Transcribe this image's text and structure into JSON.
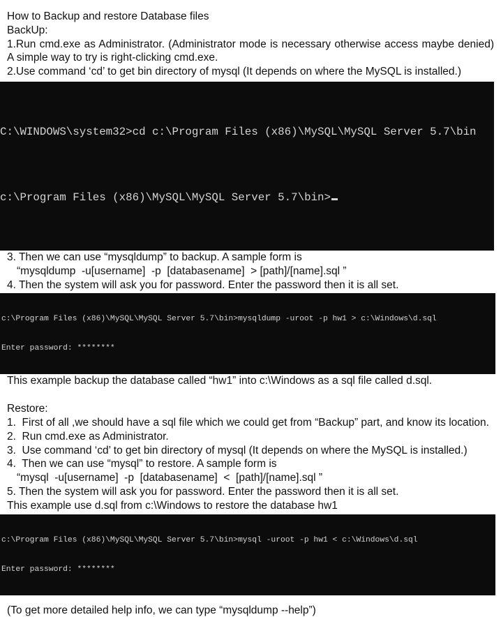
{
  "title": "How to Backup and restore Database files",
  "backup": {
    "heading": "BackUp:",
    "step1": "1.Run cmd.exe as Administrator. (Administrator mode is necessary otherwise access maybe denied) A simple way to try is right-clicking cmd.exe.",
    "step2": "2.Use command ‘cd’ to get bin directory of mysql (It depends on where the MySQL is installed.)",
    "console_cd": {
      "line1": "C:\\WINDOWS\\system32>cd c:\\Program Files (x86)\\MySQL\\MySQL Server 5.7\\bin",
      "line2": "c:\\Program Files (x86)\\MySQL\\MySQL Server 5.7\\bin>"
    },
    "step3": "3. Then we can use “mysqldump” to backup. A sample form is",
    "step3_form": "“mysqldump  -u[username]  -p  [databasename]  > [path]/[name].sql ”",
    "step4": "4. Then the system will ask you for password. Enter the password then it is all set.",
    "console_dump": {
      "line1": "c:\\Program Files (x86)\\MySQL\\MySQL Server 5.7\\bin>mysqldump -uroot -p hw1 > c:\\Windows\\d.sql",
      "line2": "Enter password: ********"
    },
    "example": "This example backup the database called “hw1” into c:\\Windows as a sql file called d.sql."
  },
  "restore": {
    "heading": "Restore:",
    "step1": "1.  First of all ,we should have a sql file which we could get from “Backup” part, and know its location.",
    "step2": "2.  Run cmd.exe as Administrator.",
    "step3": "3.  Use command ‘cd’ to get bin directory of mysql (It depends on where the MySQL is installed.)",
    "step4": "4.  Then we can use “mysql” to restore. A sample form is",
    "step4_form": "“mysql  -u[username]  -p  [databasename]  <  [path]/[name].sql ”",
    "step5": "5. Then the system will ask you for password. Enter the password then it is all set.",
    "example": "This example use d.sql from c:\\Windows to restore the database hw1",
    "console_restore": {
      "line1": "c:\\Program Files (x86)\\MySQL\\MySQL Server 5.7\\bin>mysql -uroot -p hw1 < c:\\Windows\\d.sql",
      "line2": "Enter password: ********"
    }
  },
  "footer": "(To get more detailed help info, we can type “mysqldump --help”)"
}
